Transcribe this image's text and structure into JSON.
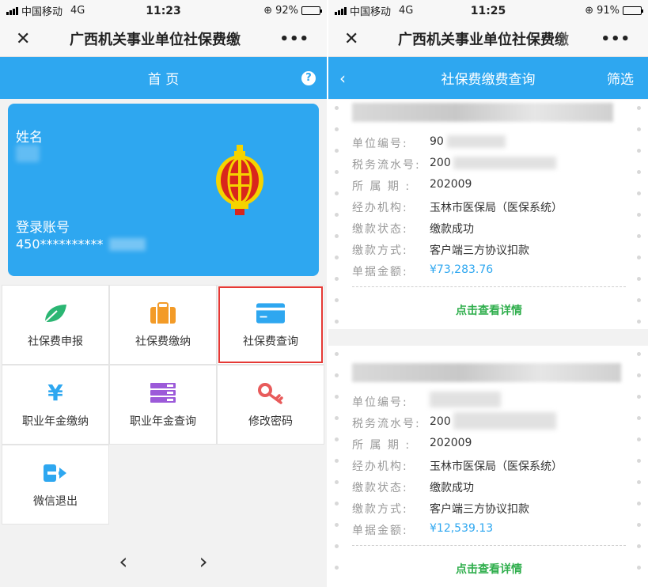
{
  "left": {
    "status": {
      "carrier": "中国移动",
      "network": "4G",
      "time": "11:23",
      "battery": "92%",
      "battery_level": 0.92
    },
    "navbar": {
      "title": "广西机关事业单位社保费缴",
      "more": "•••"
    },
    "header": {
      "title": "首 页",
      "help": "?"
    },
    "card": {
      "name_label": "姓名",
      "account_label": "登录账号",
      "account_value": "450**********"
    },
    "menu": [
      {
        "label": "社保费申报",
        "icon": "leaf-icon"
      },
      {
        "label": "社保费缴纳",
        "icon": "briefcase-icon"
      },
      {
        "label": "社保费查询",
        "icon": "card-icon"
      },
      {
        "label": "职业年金缴纳",
        "icon": "yuan-icon"
      },
      {
        "label": "职业年金查询",
        "icon": "list-icon"
      },
      {
        "label": "修改密码",
        "icon": "key-icon"
      },
      {
        "label": "微信退出",
        "icon": "exit-icon"
      }
    ],
    "pager": {
      "prev": "‹",
      "next": "›"
    }
  },
  "right": {
    "status": {
      "carrier": "中国移动",
      "network": "4G",
      "time": "11:25",
      "battery": "91%",
      "battery_level": 0.91
    },
    "navbar": {
      "title": "广西机关事业单位社保费缴",
      "more": "•••"
    },
    "header": {
      "title": "社保费缴费查询",
      "back": "‹",
      "filter": "筛选"
    },
    "labels": {
      "unit_no": "单位编号:",
      "serial_no": "税务流水号:",
      "period": "所 属 期 :",
      "agency": "经办机构:",
      "status": "缴款状态:",
      "method": "缴款方式:",
      "amount": "单据金额:"
    },
    "records": [
      {
        "unit_no": "90",
        "serial_no": "200",
        "period": "202009",
        "agency": "玉林市医保局（医保系统）",
        "status": "缴款成功",
        "method": "客户端三方协议扣款",
        "amount": "¥73,283.76",
        "detail": "点击查看详情"
      },
      {
        "unit_no": "",
        "serial_no": "200",
        "period": "202009",
        "agency": "玉林市医保局（医保系统）",
        "status": "缴款成功",
        "method": "客户端三方协议扣款",
        "amount": "¥12,539.13",
        "detail": "点击查看详情"
      }
    ]
  }
}
